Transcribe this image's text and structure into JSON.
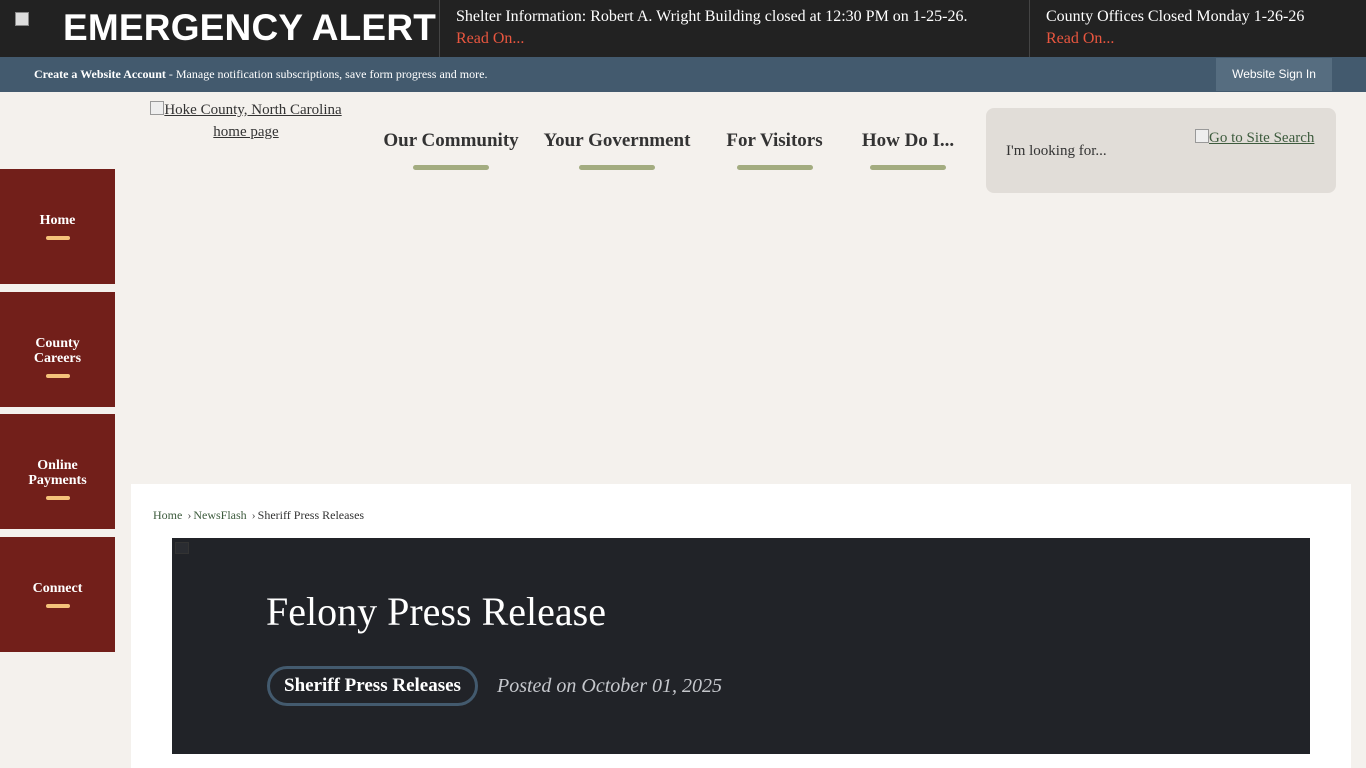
{
  "alert_bar": {
    "brand": "EMERGENCY ALERT",
    "items": [
      {
        "title": "Shelter Information: Robert A. Wright Building closed at 12:30 PM on 1-25-26.",
        "link": "Read On..."
      },
      {
        "title": "County Offices Closed Monday 1-26-26",
        "link": "Read On..."
      }
    ]
  },
  "account_bar": {
    "create_label": "Create a Website Account",
    "description": " - Manage notification subscriptions, save form progress and more.",
    "signin_label": "Website Sign In"
  },
  "logo": {
    "alt_text": "Hoke County, North Carolina home page"
  },
  "nav": {
    "items": [
      "Our Community",
      "Your Government",
      "For Visitors",
      "How Do I..."
    ]
  },
  "search": {
    "placeholder": "I'm looking for...",
    "link_alt": "Go to Site Search"
  },
  "side_buttons": [
    "Home",
    "County Careers",
    "Online Payments",
    "Connect"
  ],
  "breadcrumb": {
    "items": [
      "Home",
      "NewsFlash",
      "Sheriff Press Releases"
    ]
  },
  "article": {
    "title": "Felony Press Release",
    "category": "Sheriff Press Releases",
    "posted": "Posted on October 01, 2025"
  },
  "colors": {
    "alert_background": "#222222",
    "account_bar": "#435a6e",
    "side_button": "#721f1a",
    "side_button_accent": "#f5c27a",
    "nav_underline": "#a3ac80",
    "hero_background": "#212328"
  }
}
